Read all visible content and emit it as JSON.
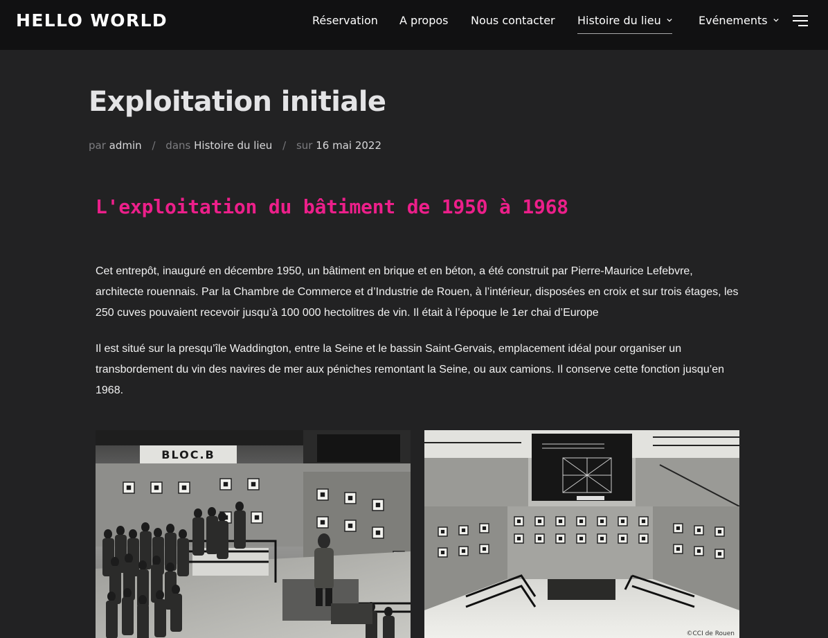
{
  "header": {
    "logo": "HELLO WORLD",
    "nav": {
      "reservation": "Réservation",
      "apropos": "A propos",
      "contact": "Nous contacter",
      "histoire": "Histoire du lieu",
      "evenements": "Evénements"
    },
    "menu_icon": "hamburger-menu-icon"
  },
  "article": {
    "title": "Exploitation initiale",
    "meta": {
      "by_label": "par",
      "author": "admin",
      "in_label": "dans",
      "category": "Histoire du lieu",
      "on_label": "sur",
      "date": "16 mai 2022",
      "separator": "/"
    },
    "heading": "L'exploitation du bâtiment de 1950 à 1968",
    "paragraphs": [
      "Cet entrepôt, inauguré en décembre 1950, un bâtiment en brique et en béton, a été construit par Pierre-Maurice Lefebvre, architecte rouennais. Par la Chambre de Commerce et d’Industrie de Rouen, à l’intérieur, disposées en croix et sur trois étages, les 250 cuves pouvaient recevoir jusqu’à 100 000 hectolitres de vin. Il était à l’époque le 1er chai d’Europe",
      "Il est situé sur la presqu’île Waddington, entre la Seine et le bassin Saint-Gervais, emplacement idéal pour organiser un transbordement du vin des navires de mer aux péniches remontant la Seine, ou aux camions. Il conserve cette fonction jusqu’en 1968."
    ],
    "gallery": {
      "photo_1_sign": "BLOC.B",
      "photo_2_credit": "©CCI de Rouen"
    }
  },
  "colors": {
    "background": "#222223",
    "header_background": "#111112",
    "heading_accent": "#ec1f8a",
    "title": "#e4e4e6",
    "text": "#f2f2f2"
  }
}
